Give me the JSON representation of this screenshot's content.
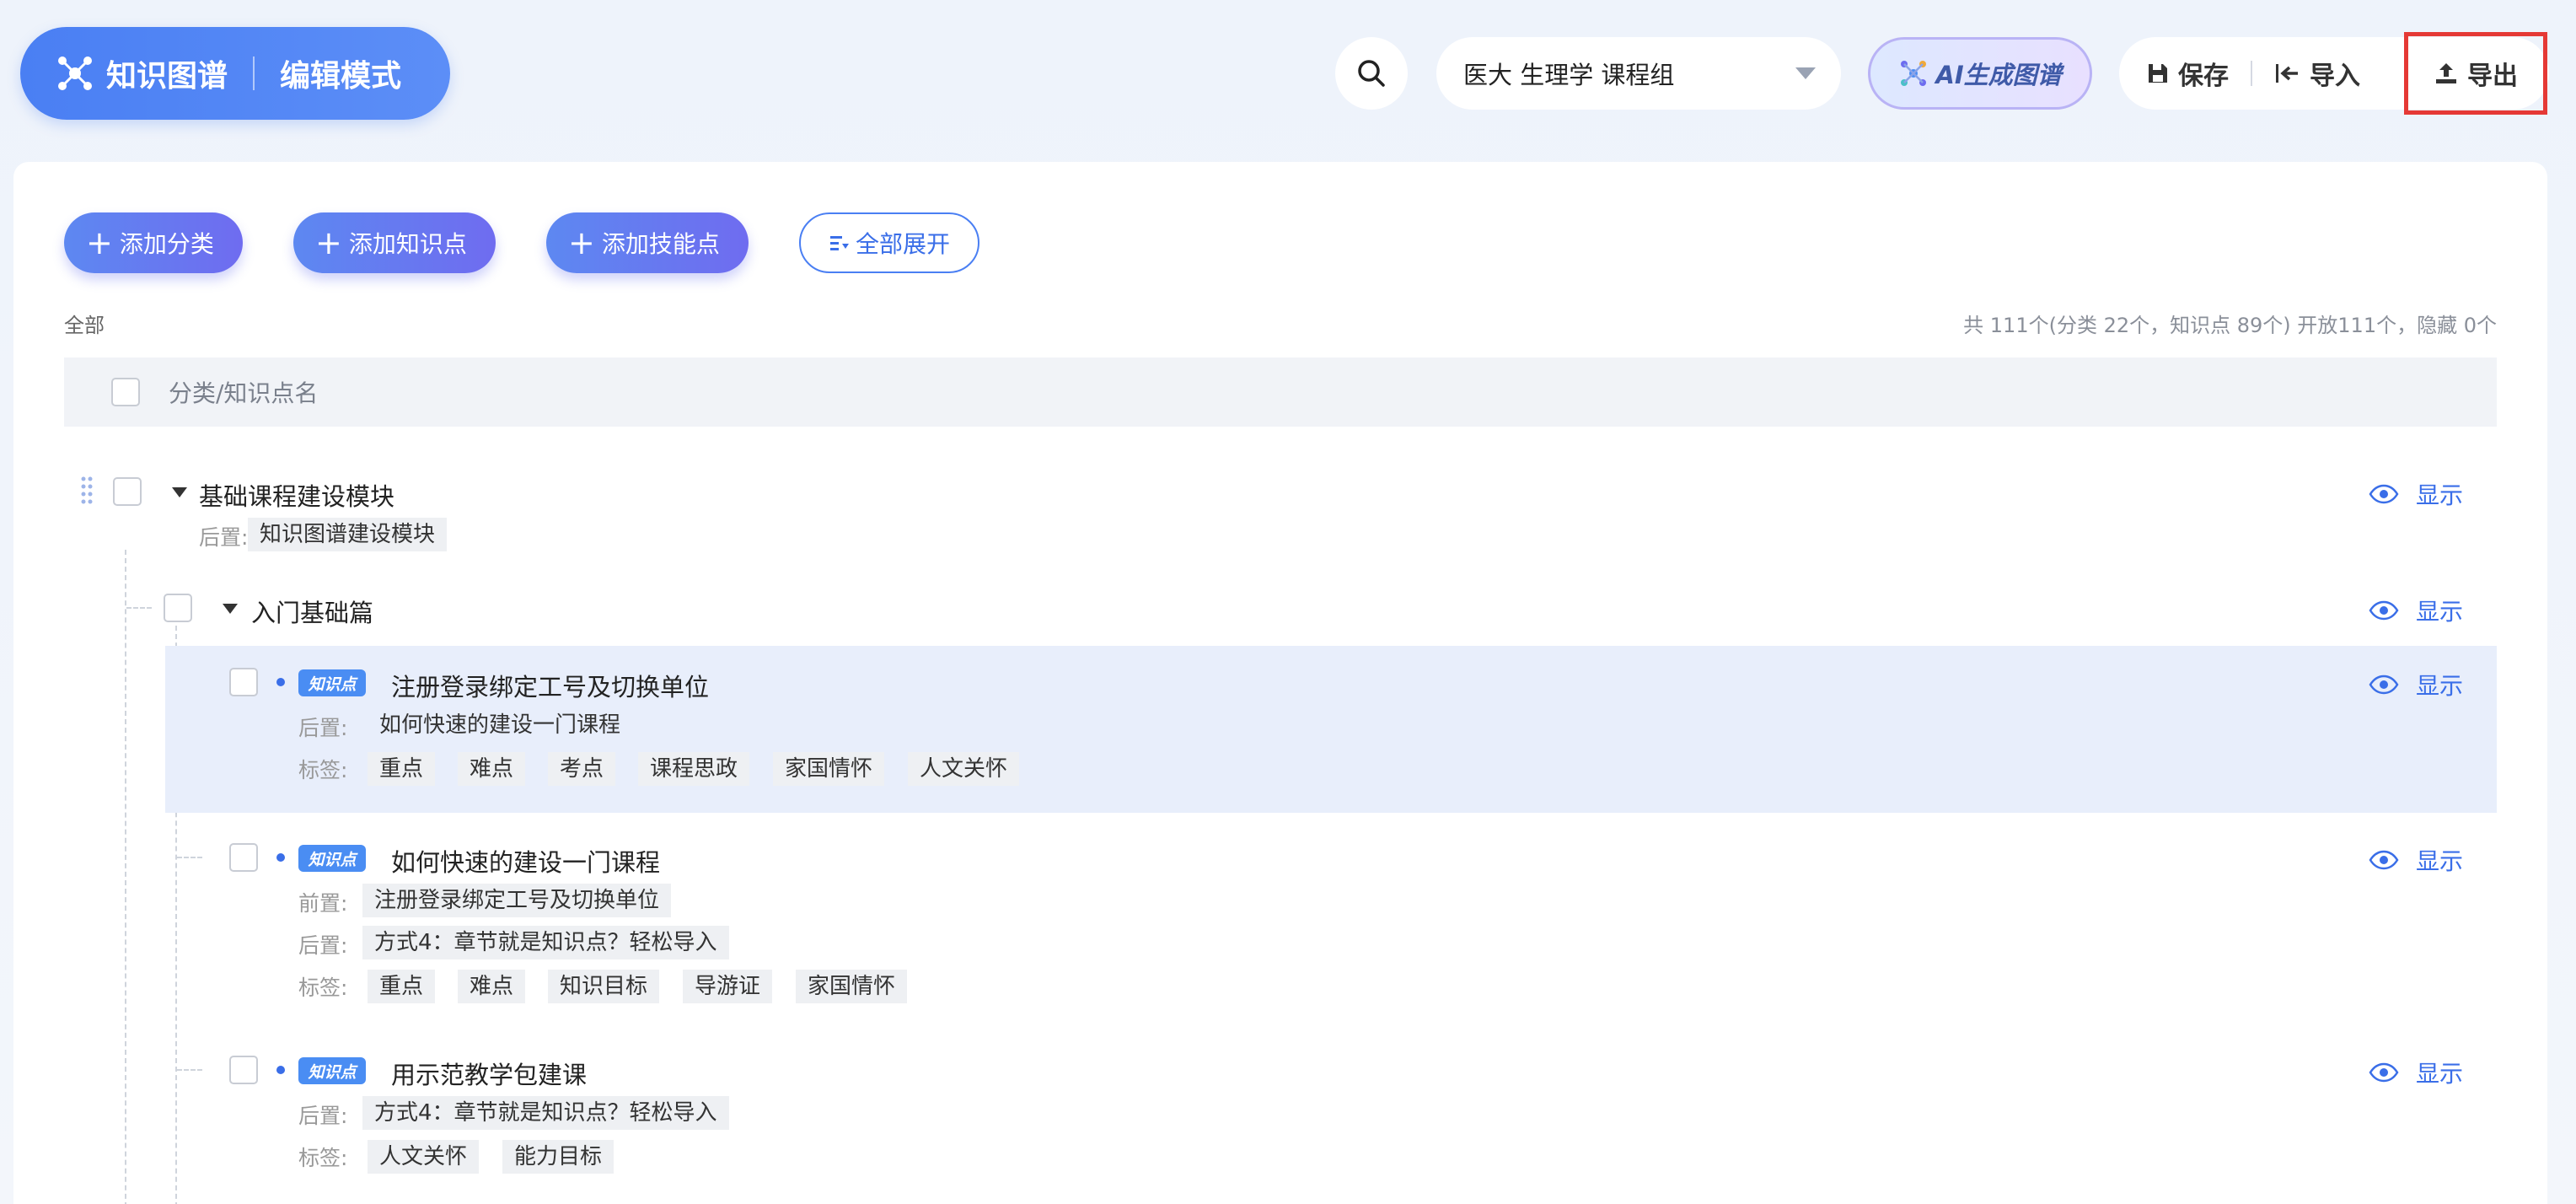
{
  "header": {
    "brand_title": "知识图谱",
    "brand_mode": "编辑模式",
    "course_select": {
      "value": "医大 生理学 课程组"
    },
    "ai_button": "AI生成图谱",
    "actions": {
      "save": "保存",
      "import": "导入",
      "export": "导出"
    }
  },
  "toolbar": {
    "add_category": "添加分类",
    "add_knowledge": "添加知识点",
    "add_skill": "添加技能点",
    "expand_all": "全部展开"
  },
  "crumb": "全部",
  "stats": "共 111个(分类 22个，知识点 89个) 开放111个，隐藏 0个",
  "table": {
    "header": "分类/知识点名"
  },
  "labels": {
    "prev": "前置:",
    "next": "后置:",
    "tags": "标签:",
    "show": "显示",
    "kp_badge": "知识点"
  },
  "tree": {
    "root": {
      "title": "基础课程建设模块",
      "next": [
        "知识图谱建设模块"
      ]
    },
    "group": {
      "title": "入门基础篇"
    },
    "items": [
      {
        "title": "注册登录绑定工号及切换单位",
        "next": [
          "如何快速的建设一门课程"
        ],
        "tags": [
          "重点",
          "难点",
          "考点",
          "课程思政",
          "家国情怀",
          "人文关怀"
        ]
      },
      {
        "title": "如何快速的建设一门课程",
        "prev": [
          "注册登录绑定工号及切换单位"
        ],
        "next": [
          "方式4：章节就是知识点？轻松导入"
        ],
        "tags": [
          "重点",
          "难点",
          "知识目标",
          "导游证",
          "家国情怀"
        ]
      },
      {
        "title": "用示范教学包建课",
        "next": [
          "方式4：章节就是知识点？轻松导入"
        ],
        "tags": [
          "人文关怀",
          "能力目标"
        ]
      }
    ]
  }
}
